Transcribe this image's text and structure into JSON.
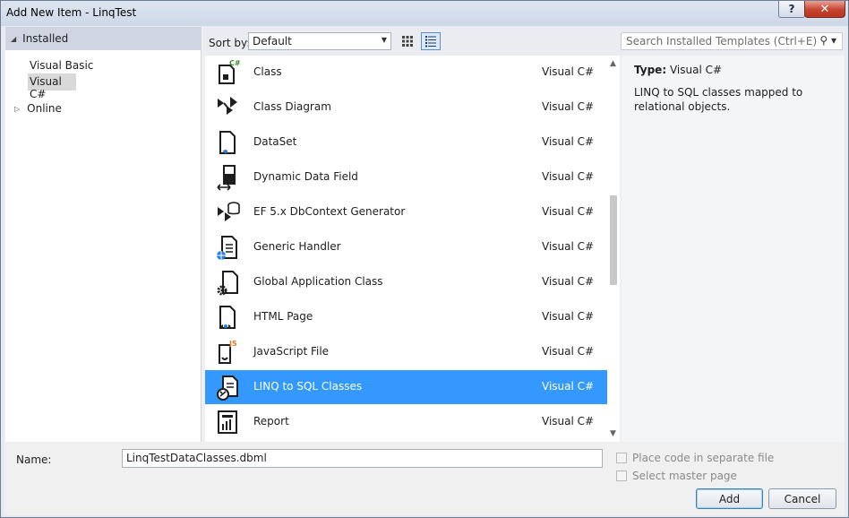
{
  "window": {
    "title": "Add New Item - LinqTest",
    "help_label": "?",
    "close_label": "✕"
  },
  "nav": {
    "installed_label": "Installed",
    "items": [
      {
        "label": "Visual Basic"
      },
      {
        "label": "Visual C#",
        "selected": true
      }
    ],
    "online_label": "Online"
  },
  "toolbar": {
    "sort_label": "Sort by:",
    "sort_value": "Default",
    "search_placeholder": "Search Installed Templates (Ctrl+E)"
  },
  "templates": [
    {
      "name": "Class",
      "lang": "Visual C#",
      "icon": "class-icon"
    },
    {
      "name": "Class Diagram",
      "lang": "Visual C#",
      "icon": "class-diagram-icon"
    },
    {
      "name": "DataSet",
      "lang": "Visual C#",
      "icon": "dataset-icon"
    },
    {
      "name": "Dynamic Data Field",
      "lang": "Visual C#",
      "icon": "dynamic-data-field-icon"
    },
    {
      "name": "EF 5.x DbContext Generator",
      "lang": "Visual C#",
      "icon": "ef-generator-icon"
    },
    {
      "name": "Generic Handler",
      "lang": "Visual C#",
      "icon": "generic-handler-icon"
    },
    {
      "name": "Global Application Class",
      "lang": "Visual C#",
      "icon": "global-application-icon"
    },
    {
      "name": "HTML Page",
      "lang": "Visual C#",
      "icon": "html-page-icon"
    },
    {
      "name": "JavaScript File",
      "lang": "Visual C#",
      "icon": "javascript-file-icon"
    },
    {
      "name": "LINQ to SQL Classes",
      "lang": "Visual C#",
      "icon": "linq-to-sql-icon",
      "selected": true
    },
    {
      "name": "Report",
      "lang": "Visual C#",
      "icon": "report-icon"
    }
  ],
  "details": {
    "type_label": "Type:",
    "type_value": "Visual C#",
    "description": "LINQ to SQL classes mapped to relational objects."
  },
  "footer": {
    "name_label": "Name:",
    "name_value": "LinqTestDataClasses.dbml",
    "place_code_label": "Place code in separate file",
    "select_master_label": "Select master page",
    "add_label": "Add",
    "cancel_label": "Cancel"
  },
  "colors": {
    "selection": "#3399ff",
    "nav_header": "#cfd6e2",
    "close_button": "#c6432e"
  }
}
